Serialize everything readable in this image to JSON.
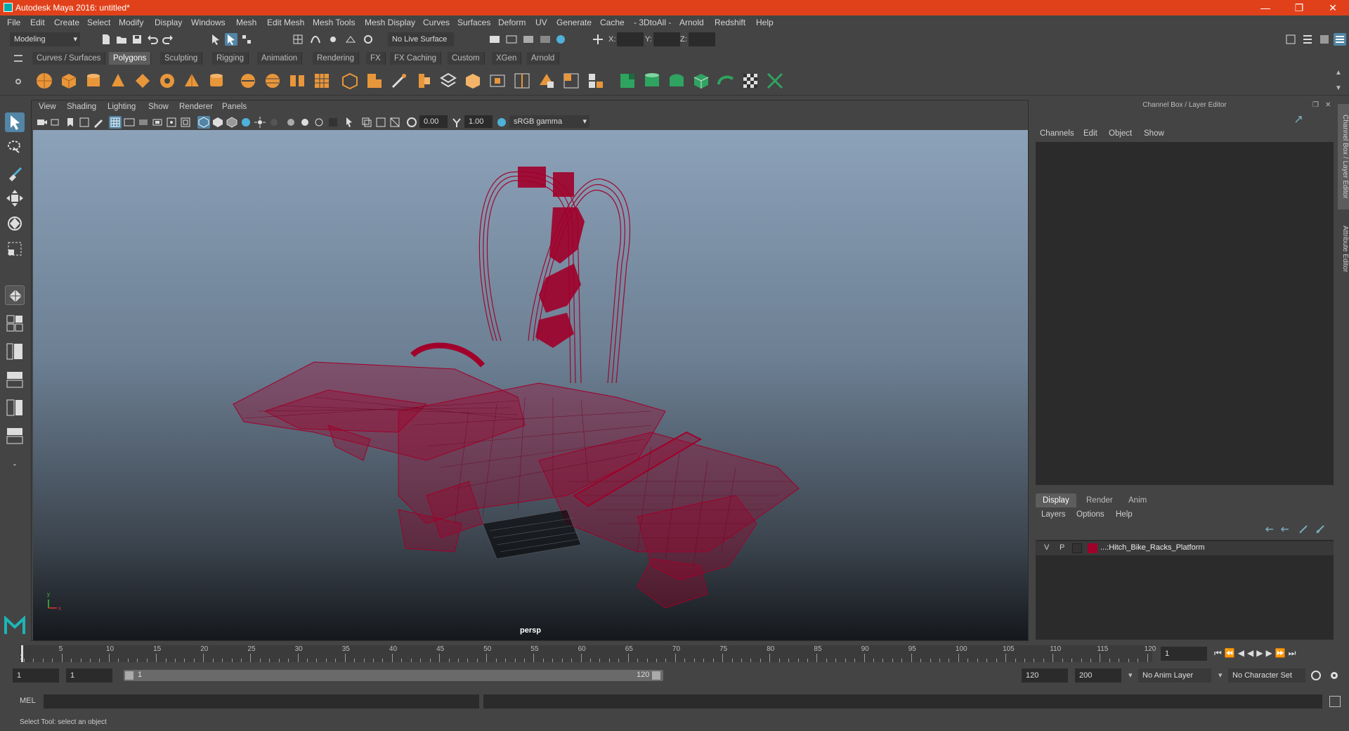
{
  "window": {
    "title": "Autodesk Maya 2016: untitled*"
  },
  "menubar": [
    "File",
    "Edit",
    "Create",
    "Select",
    "Modify",
    "Display",
    "Windows",
    "Mesh",
    "Edit Mesh",
    "Mesh Tools",
    "Mesh Display",
    "Curves",
    "Surfaces",
    "Deform",
    "UV",
    "Generate",
    "Cache",
    "- 3DtoAll -",
    "Arnold",
    "Redshift",
    "Help"
  ],
  "statusline": {
    "mode": "Modeling",
    "live_surface": "No Live Surface",
    "x_label": "X:",
    "y_label": "Y:",
    "z_label": "Z:"
  },
  "shelf": {
    "tabs": [
      "Curves / Surfaces",
      "Polygons",
      "Sculpting",
      "Rigging",
      "Animation",
      "Rendering",
      "FX",
      "FX Caching",
      "Custom",
      "XGen",
      "Arnold"
    ],
    "active_tab": "Polygons"
  },
  "viewport": {
    "menu": [
      "View",
      "Shading",
      "Lighting",
      "Show",
      "Renderer",
      "Panels"
    ],
    "exposure": "0.00",
    "gamma": "1.00",
    "color_space": "sRGB gamma",
    "camera_label": "persp",
    "axis_y": "y",
    "axis_x": "x"
  },
  "channel_box": {
    "title": "Channel Box / Layer Editor",
    "menu": [
      "Channels",
      "Edit",
      "Object",
      "Show"
    ]
  },
  "layer_editor": {
    "tabs": [
      "Display",
      "Render",
      "Anim"
    ],
    "active_tab": "Display",
    "menu": [
      "Layers",
      "Options",
      "Help"
    ],
    "layers": [
      {
        "v": "V",
        "p": "P",
        "color": "#a0002a",
        "name": "...:Hitch_Bike_Racks_Platform"
      }
    ]
  },
  "side_tabs": [
    "Channel Box / Layer Editor",
    "Attribute Editor"
  ],
  "time_slider": {
    "ticks": [
      "5",
      "10",
      "15",
      "20",
      "25",
      "30",
      "35",
      "40",
      "45",
      "50",
      "55",
      "60",
      "65",
      "70",
      "75",
      "80",
      "85",
      "90",
      "95",
      "100",
      "105",
      "110",
      "115",
      "120"
    ],
    "start_label": "1",
    "current_frame": "1"
  },
  "range_slider": {
    "start": "1",
    "playback_start": "1",
    "range_start_label": "1",
    "range_end_label": "120",
    "playback_end": "120",
    "end": "200",
    "anim_layer": "No Anim Layer",
    "character_set": "No Character Set"
  },
  "command_line": {
    "label": "MEL"
  },
  "help_line": {
    "text": "Select Tool: select an object"
  },
  "colors": {
    "accent": "#e1411a",
    "wire": "#a0002a",
    "active_tool": "#5285a6"
  }
}
